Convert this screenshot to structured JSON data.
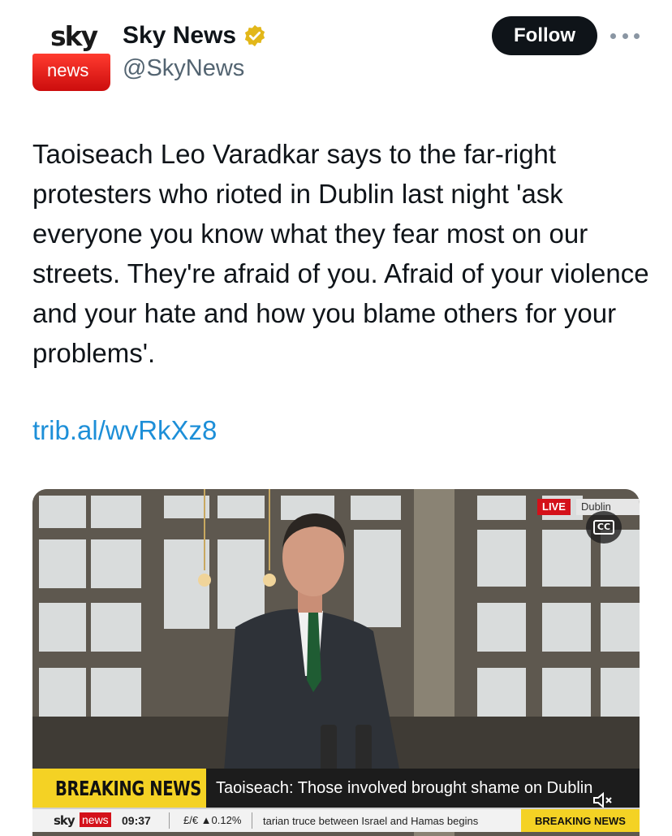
{
  "account": {
    "avatar_logo_top": "sky",
    "avatar_logo_bottom": "news",
    "display_name": "Sky News",
    "handle": "@SkyNews",
    "verified_badge_icon": "gold-verified-badge-icon",
    "verified_color": "#e2b719"
  },
  "actions": {
    "follow_label": "Follow",
    "more_icon": "more-dots-icon"
  },
  "tweet": {
    "text": "Taoiseach Leo Varadkar says to the far-right protesters who rioted in Dublin last night 'ask everyone you know what they fear most on our streets. They're afraid of you. Afraid of your violence and your hate and how you blame others for your problems'.",
    "link": "trib.al/wvRkXz8"
  },
  "media": {
    "live_label": "LIVE",
    "location_label": "Dublin",
    "cc_label": "CC",
    "breaking_label": "BREAKING NEWS",
    "headline": "Taoiseach: Those involved brought shame on Dublin",
    "ticker": {
      "logo_sky": "sky",
      "logo_news": "news",
      "time": "09:37",
      "fx": "£/€ ▲0.12%",
      "scroll_text": "tarian truce between Israel and Hamas begins",
      "breaking": "BREAKING NEWS"
    },
    "mute_icon": "speaker-muted-icon"
  },
  "colors": {
    "link": "#1d8fd8",
    "follow_bg": "#0f1419",
    "breaking_yellow": "#f4d224",
    "live_red": "#d4111a"
  }
}
